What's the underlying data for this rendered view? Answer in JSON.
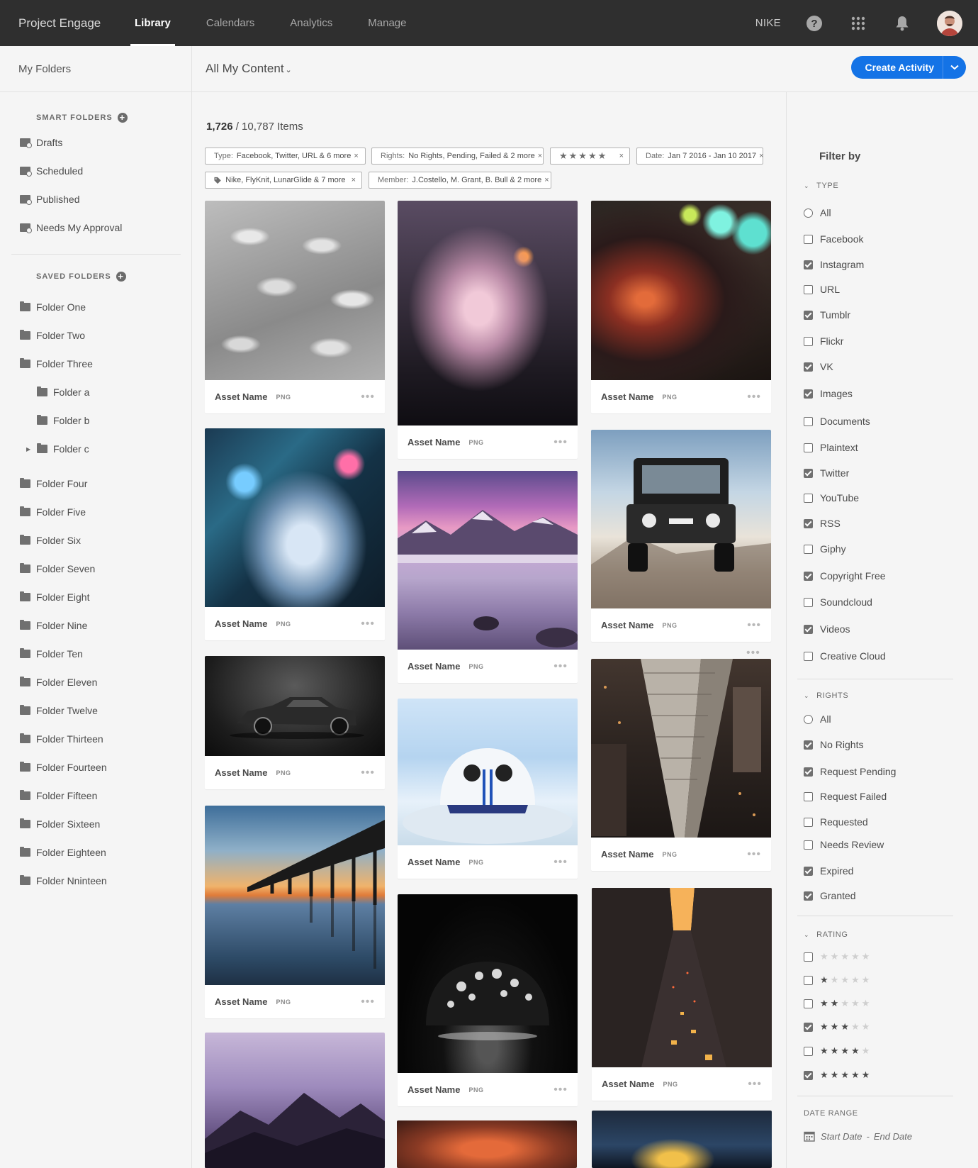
{
  "topbar": {
    "brand": "Project Engage",
    "nav": [
      "Library",
      "Calendars",
      "Analytics",
      "Manage"
    ],
    "active_nav": "Library",
    "org": "NIKE"
  },
  "sidebar": {
    "header": "My Folders",
    "smart_title": "SMART FOLDERS",
    "smart": [
      "Drafts",
      "Scheduled",
      "Published",
      "Needs My Approval"
    ],
    "saved_title": "SAVED FOLDERS",
    "folders_a": [
      "Folder One",
      "Folder Two",
      "Folder Three"
    ],
    "subfolders": [
      "Folder a",
      "Folder b",
      "Folder c"
    ],
    "folders_b": [
      "Folder Four",
      "Folder Five",
      "Folder Six",
      "Folder Seven",
      "Folder Eight",
      "Folder Nine",
      "Folder Ten",
      "Folder Eleven",
      "Folder Twelve",
      "Folder Thirteen",
      "Folder Fourteen",
      "Folder Fifteen",
      "Folder Sixteen",
      "Folder Eighteen",
      "Folder Nninteen"
    ]
  },
  "main": {
    "title": "All My Content",
    "create_label": "Create Activity",
    "count_shown": "1,726",
    "count_total": "/ 10,787 Items"
  },
  "chips": {
    "type_key": "Type:",
    "type_val": "Facebook, Twitter, URL & 6 more",
    "rights_key": "Rights:",
    "rights_val": "No Rights, Pending, Failed & 2 more",
    "rating_stars": "★★★★★",
    "date_key": "Date:",
    "date_val": "Jan 7 2016 - Jan 10 2017",
    "tags_val": "Nike, FlyKnit, LunarGlide & 7 more",
    "member_key": "Member:",
    "member_val": "J.Costello, M. Grant, B. Bull & 2 more",
    "close": "×"
  },
  "card": {
    "name": "Asset Name",
    "format": "PNG",
    "menu": "•••"
  },
  "filters": {
    "title": "Filter by",
    "type_title": "TYPE",
    "type_all": "All",
    "types": [
      {
        "label": "Facebook",
        "checked": false
      },
      {
        "label": "Instagram",
        "checked": true
      },
      {
        "label": "URL",
        "checked": false
      },
      {
        "label": "Tumblr",
        "checked": true
      },
      {
        "label": "Flickr",
        "checked": false
      },
      {
        "label": "VK",
        "checked": true
      },
      {
        "label": "Images",
        "checked": true
      },
      {
        "label": "Documents",
        "checked": false
      },
      {
        "label": "Plaintext",
        "checked": false
      },
      {
        "label": "Twitter",
        "checked": true
      },
      {
        "label": "YouTube",
        "checked": false
      },
      {
        "label": "RSS",
        "checked": true
      },
      {
        "label": "Giphy",
        "checked": false
      },
      {
        "label": "Copyright Free",
        "checked": true
      },
      {
        "label": "Soundcloud",
        "checked": false
      },
      {
        "label": "Videos",
        "checked": true
      },
      {
        "label": "Creative Cloud",
        "checked": false
      }
    ],
    "rights_title": "RIGHTS",
    "rights_all": "All",
    "rights": [
      {
        "label": "No Rights",
        "checked": true
      },
      {
        "label": "Request Pending",
        "checked": true
      },
      {
        "label": "Request Failed",
        "checked": false
      },
      {
        "label": "Requested",
        "checked": false
      },
      {
        "label": "Needs Review",
        "checked": false
      },
      {
        "label": "Expired",
        "checked": true
      },
      {
        "label": "Granted",
        "checked": true
      }
    ],
    "rating_title": "RATING",
    "ratings": [
      {
        "stars": 0,
        "checked": false
      },
      {
        "stars": 1,
        "checked": false
      },
      {
        "stars": 2,
        "checked": false
      },
      {
        "stars": 3,
        "checked": true
      },
      {
        "stars": 4,
        "checked": false
      },
      {
        "stars": 5,
        "checked": true
      }
    ],
    "date_title": "DATE RANGE",
    "start_date": "Start Date",
    "date_sep": "-",
    "end_date": "End Date"
  },
  "colors": {
    "accent": "#1473e6",
    "topbar": "#2f2f2f",
    "bg": "#f5f5f5"
  }
}
